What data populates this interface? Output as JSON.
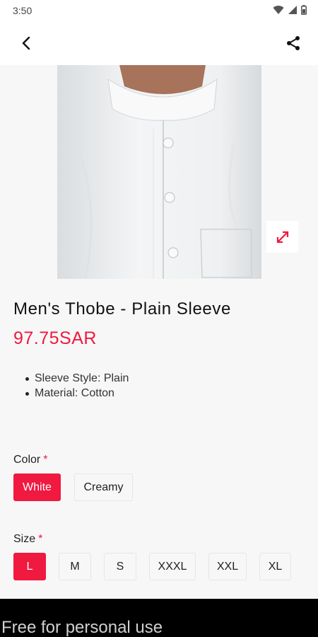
{
  "status_bar": {
    "time": "3:50"
  },
  "product": {
    "title": "Men's Thobe - Plain Sleeve",
    "price": "97.75SAR",
    "features": [
      "Sleeve Style: Plain",
      "Material: Cotton"
    ]
  },
  "options": {
    "color": {
      "label": "Color",
      "required_mark": "*",
      "choices": [
        "White",
        "Creamy"
      ],
      "selected": "White"
    },
    "size": {
      "label": "Size",
      "required_mark": "*",
      "choices": [
        "L",
        "M",
        "S",
        "XXXL",
        "XXL",
        "XL"
      ],
      "selected": "L"
    }
  },
  "watermark": "Free for personal use",
  "colors": {
    "accent": "#f0193f",
    "background": "#f7f7f7"
  }
}
